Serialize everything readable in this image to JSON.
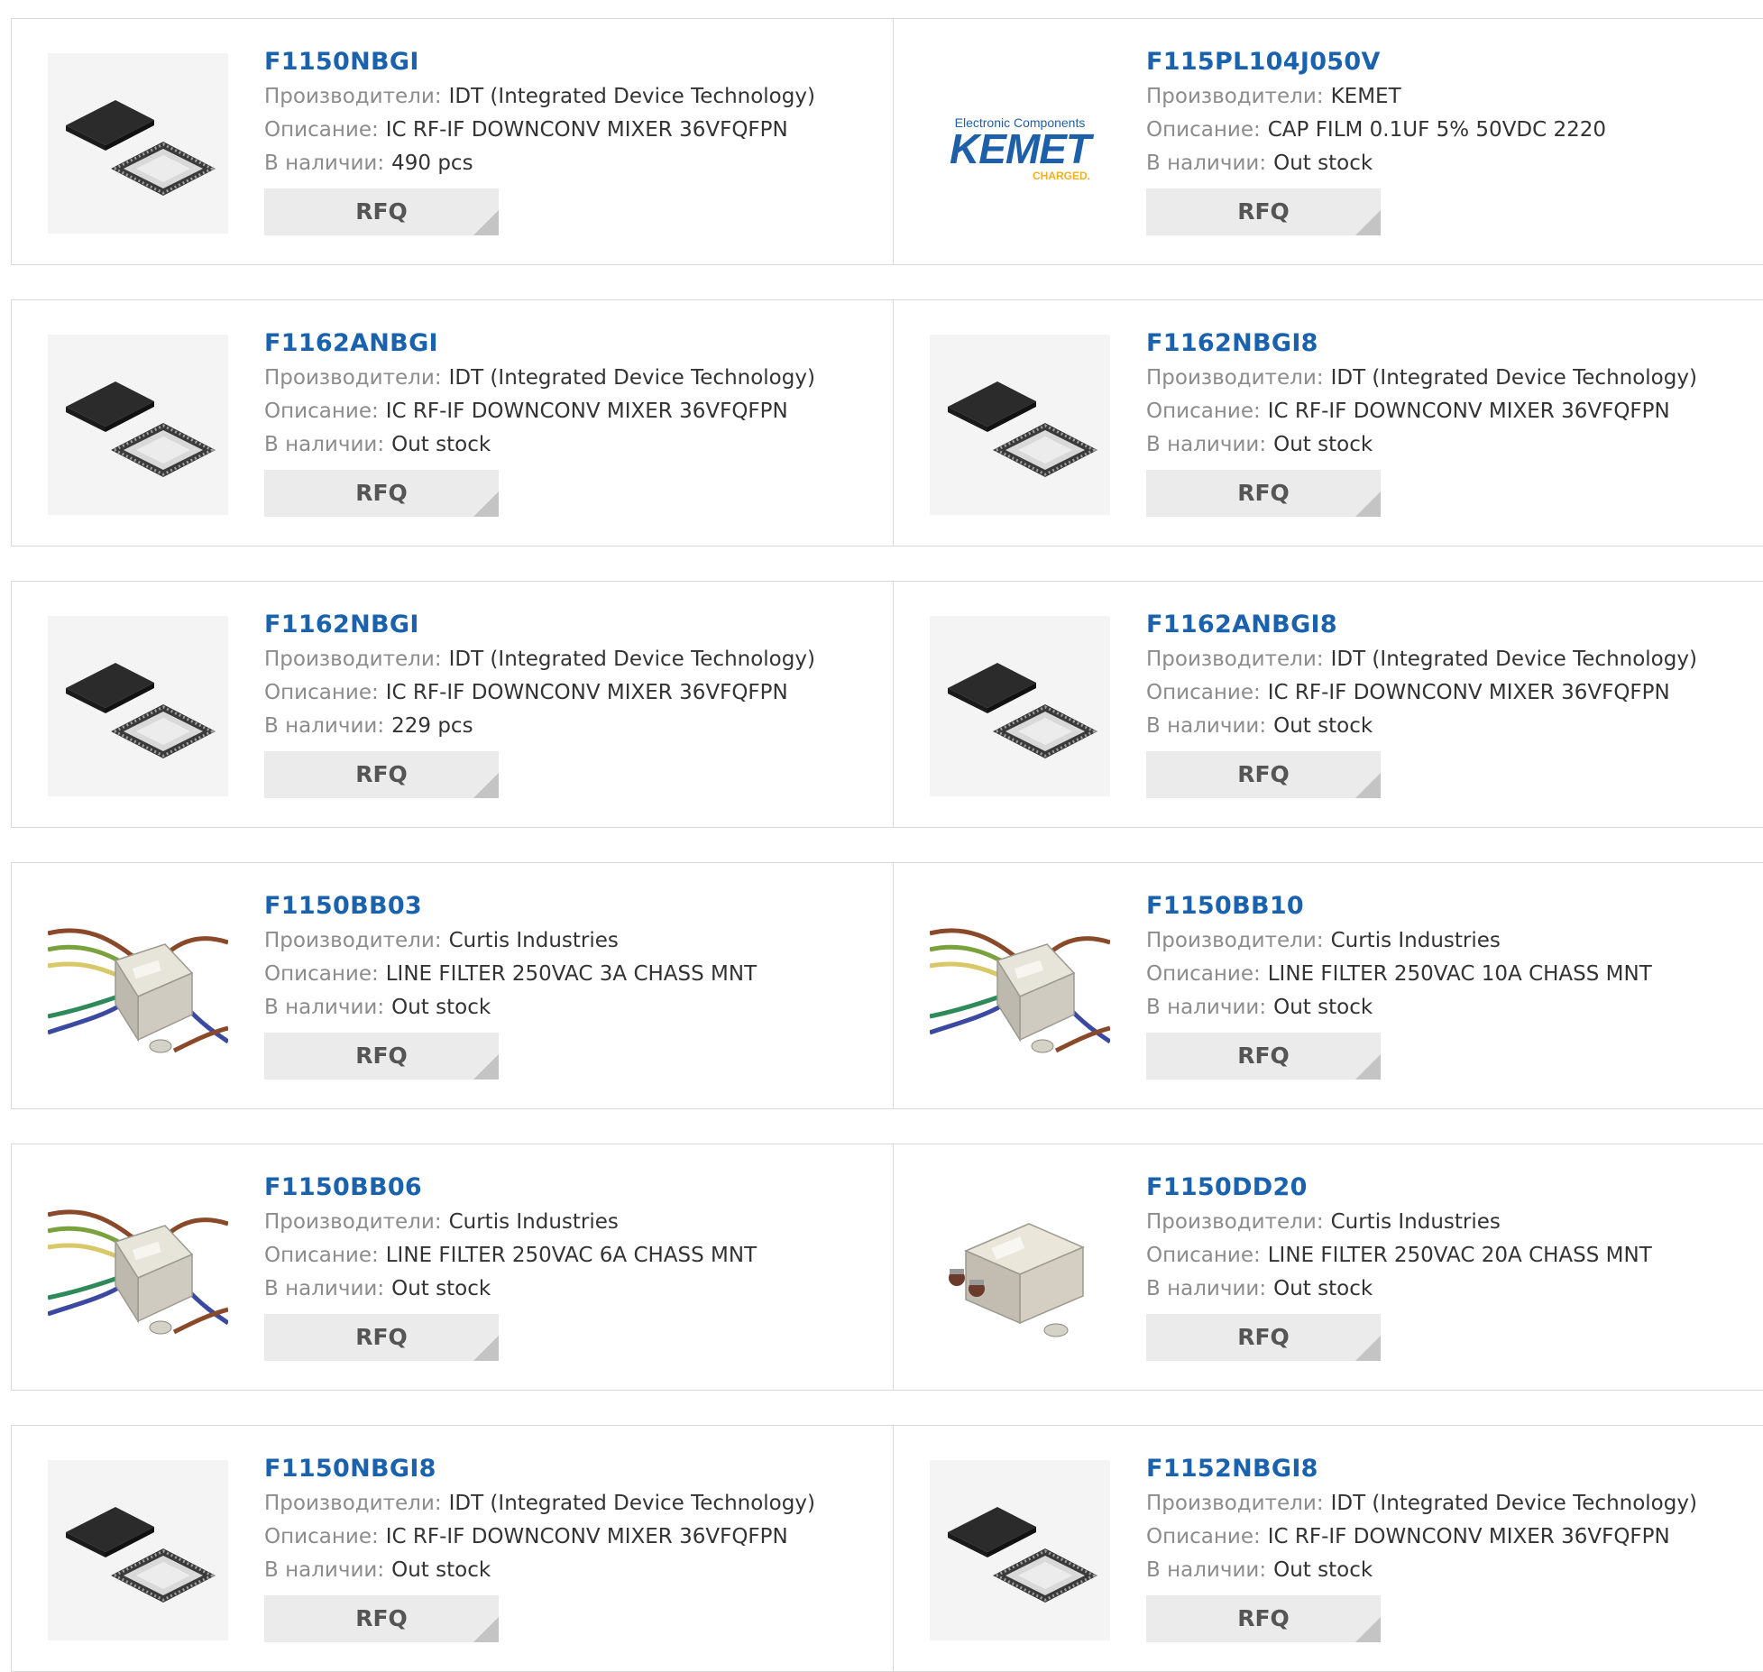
{
  "labels": {
    "manufacturer": "Производители:",
    "description": "Описание:",
    "stock": "В наличии:",
    "rfq": "RFQ"
  },
  "products": [
    {
      "part": "F1150NBGI",
      "manufacturer": "IDT (Integrated Device Technology)",
      "description": "IC RF-IF DOWNCONV MIXER 36VFQFPN",
      "stock": "490 pcs",
      "image": "qfn-chip-icon"
    },
    {
      "part": "F115PL104J050V",
      "manufacturer": "KEMET",
      "description": "CAP FILM 0.1UF 5% 50VDC 2220",
      "stock": "Out stock",
      "image": "kemet-logo",
      "logo": {
        "tagline": "Electronic Components",
        "brand": "KEMET",
        "slogan": "CHARGED."
      }
    },
    {
      "part": "F1162ANBGI",
      "manufacturer": "IDT (Integrated Device Technology)",
      "description": "IC RF-IF DOWNCONV MIXER 36VFQFPN",
      "stock": "Out stock",
      "image": "qfn-chip-icon"
    },
    {
      "part": "F1162NBGI8",
      "manufacturer": "IDT (Integrated Device Technology)",
      "description": "IC RF-IF DOWNCONV MIXER 36VFQFPN",
      "stock": "Out stock",
      "image": "qfn-chip-icon"
    },
    {
      "part": "F1162NBGI",
      "manufacturer": "IDT (Integrated Device Technology)",
      "description": "IC RF-IF DOWNCONV MIXER 36VFQFPN",
      "stock": "229 pcs",
      "image": "qfn-chip-icon"
    },
    {
      "part": "F1162ANBGI8",
      "manufacturer": "IDT (Integrated Device Technology)",
      "description": "IC RF-IF DOWNCONV MIXER 36VFQFPN",
      "stock": "Out stock",
      "image": "qfn-chip-icon"
    },
    {
      "part": "F1150BB03",
      "manufacturer": "Curtis Industries",
      "description": "LINE FILTER 250VAC 3A CHASS MNT",
      "stock": "Out stock",
      "image": "line-filter-wires-icon"
    },
    {
      "part": "F1150BB10",
      "manufacturer": "Curtis Industries",
      "description": "LINE FILTER 250VAC 10A CHASS MNT",
      "stock": "Out stock",
      "image": "line-filter-wires-icon"
    },
    {
      "part": "F1150BB06",
      "manufacturer": "Curtis Industries",
      "description": "LINE FILTER 250VAC 6A CHASS MNT",
      "stock": "Out stock",
      "image": "line-filter-wires-icon"
    },
    {
      "part": "F1150DD20",
      "manufacturer": "Curtis Industries",
      "description": "LINE FILTER 250VAC 20A CHASS MNT",
      "stock": "Out stock",
      "image": "line-filter-terminal-icon"
    },
    {
      "part": "F1150NBGI8",
      "manufacturer": "IDT (Integrated Device Technology)",
      "description": "IC RF-IF DOWNCONV MIXER 36VFQFPN",
      "stock": "Out stock",
      "image": "qfn-chip-icon"
    },
    {
      "part": "F1152NBGI8",
      "manufacturer": "IDT (Integrated Device Technology)",
      "description": "IC RF-IF DOWNCONV MIXER 36VFQFPN",
      "stock": "Out stock",
      "image": "qfn-chip-icon"
    }
  ]
}
